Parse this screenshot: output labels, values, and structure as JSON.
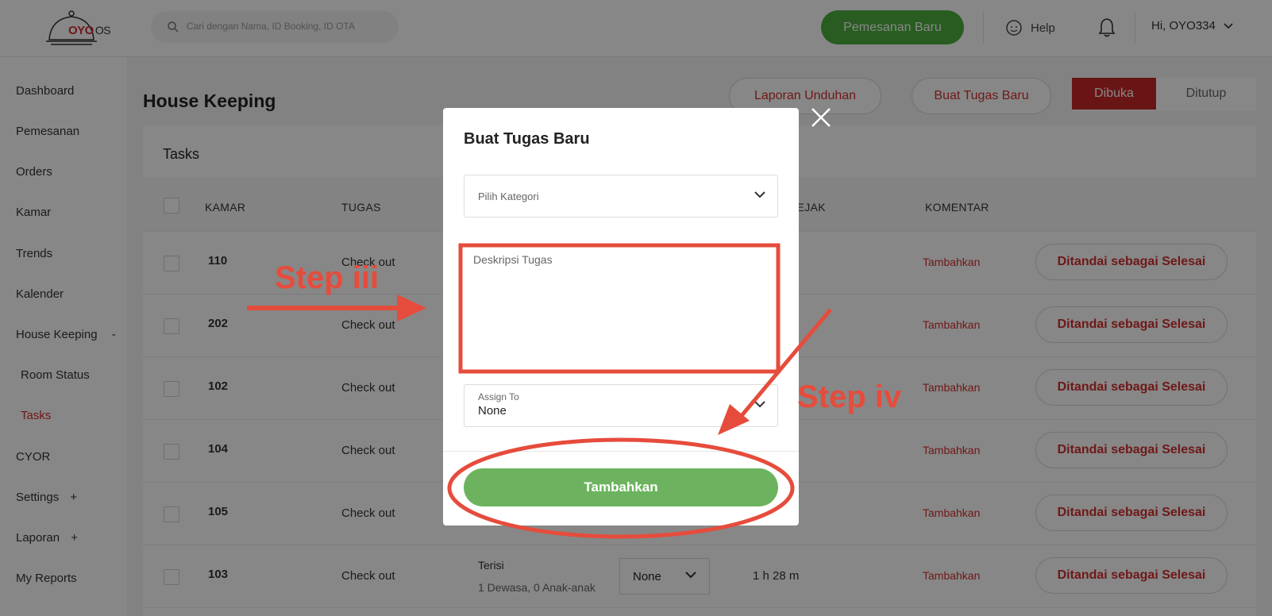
{
  "header": {
    "logo_brand": "OYO",
    "logo_suffix": "OS",
    "search_placeholder": "Cari dengan Nama, ID Booking, ID OTA",
    "new_booking_label": "Pemesanan Baru",
    "help_label": "Help",
    "user_greeting": "Hi, OYO334"
  },
  "sidebar": {
    "items": [
      {
        "label": "Dashboard"
      },
      {
        "label": "Pemesanan"
      },
      {
        "label": "Orders"
      },
      {
        "label": "Kamar"
      },
      {
        "label": "Trends"
      },
      {
        "label": "Kalender"
      },
      {
        "label": "House Keeping",
        "toggle": "-"
      },
      {
        "label": "Room Status"
      },
      {
        "label": "Tasks",
        "active": true
      },
      {
        "label": "CYOR"
      },
      {
        "label": "Settings",
        "toggle": "+"
      },
      {
        "label": "Laporan",
        "toggle": "+"
      },
      {
        "label": "My Reports"
      }
    ]
  },
  "main": {
    "title": "House Keeping",
    "download_report_label": "Laporan Unduhan",
    "new_task_label": "Buat Tugas Baru",
    "toggle_open_label": "Dibuka",
    "toggle_closed_label": "Ditutup",
    "card_title": "Tasks",
    "columns": {
      "room": "KAMAR",
      "task": "TUGAS",
      "since": "SEJAK",
      "comment": "KOMENTAR"
    },
    "rows": [
      {
        "room": "110",
        "task": "Check out",
        "comment": "Tambahkan",
        "action": "Ditandai sebagai Selesai"
      },
      {
        "room": "202",
        "task": "Check out",
        "comment": "Tambahkan",
        "action": "Ditandai sebagai Selesai"
      },
      {
        "room": "102",
        "task": "Check out",
        "comment": "Tambahkan",
        "action": "Ditandai sebagai Selesai"
      },
      {
        "room": "104",
        "task": "Check out",
        "comment": "Tambahkan",
        "action": "Ditandai sebagai Selesai"
      },
      {
        "room": "105",
        "task": "Check out",
        "comment": "Tambahkan",
        "action": "Ditandai sebagai Selesai"
      },
      {
        "room": "103",
        "task": "Check out",
        "status": "Terisi",
        "guests": "1 Dewasa, 0 Anak-anak",
        "assignee": "None",
        "since": "1 h 28 m",
        "comment": "Tambahkan",
        "action": "Ditandai sebagai Selesai"
      }
    ]
  },
  "modal": {
    "title": "Buat Tugas Baru",
    "category_placeholder": "Pilih Kategori",
    "description_placeholder": "Deskripsi Tugas",
    "assign_label": "Assign To",
    "assign_value": "None",
    "submit_label": "Tambahkan"
  },
  "annotations": {
    "step3": "Step iii",
    "step4": "Step iv",
    "color": "#e64c3c"
  },
  "colors": {
    "brand_red": "#d32f2f",
    "green_button": "#4cae3f",
    "submit_green": "#6db35f"
  }
}
